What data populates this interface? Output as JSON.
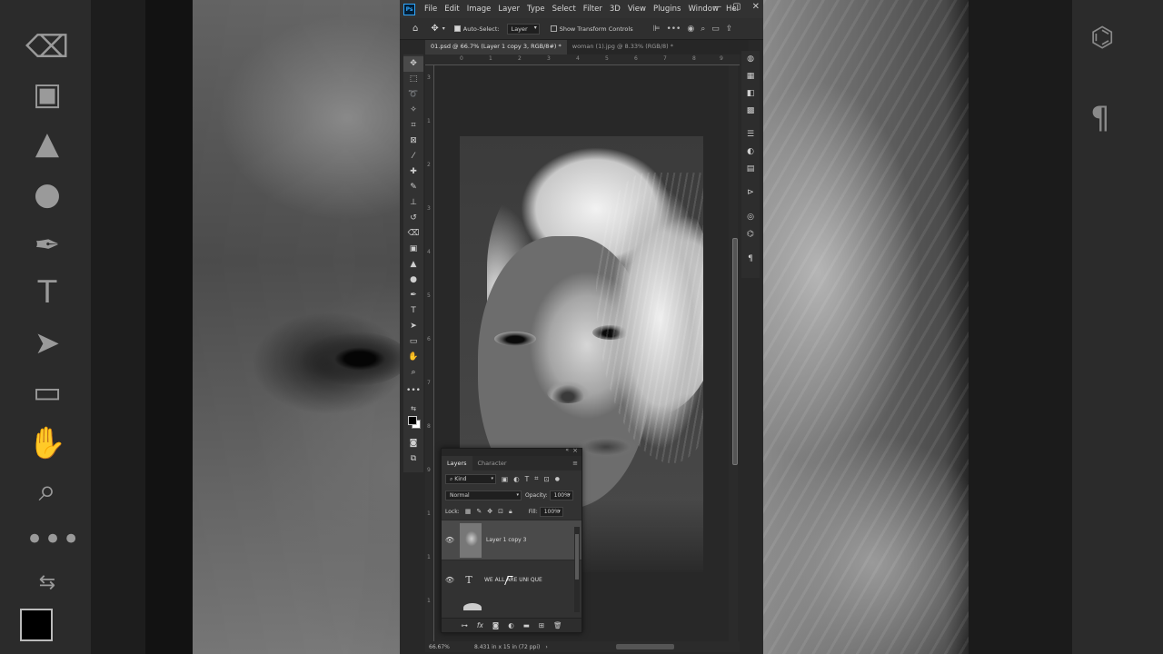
{
  "menubar": {
    "app_icon": "Ps",
    "items": [
      "File",
      "Edit",
      "Image",
      "Layer",
      "Type",
      "Select",
      "Filter",
      "3D",
      "View",
      "Plugins",
      "Window",
      "Hel"
    ],
    "window_controls": [
      "—",
      "▢",
      "✕"
    ]
  },
  "options_bar": {
    "auto_select_label": "Auto-Select:",
    "auto_select_value": "Layer",
    "show_transform_label": "Show Transform Controls"
  },
  "tabs": [
    {
      "label": "01.psd @ 66.7% (Layer 1 copy 3, RGB/8#) *",
      "active": true
    },
    {
      "label": "woman (1).jpg @ 8.33% (RGB/8) *",
      "active": false
    }
  ],
  "ruler": {
    "h_ticks": [
      "0",
      "1",
      "2",
      "3",
      "4",
      "5",
      "6",
      "7",
      "8",
      "9"
    ],
    "v_ticks": [
      "3",
      "1",
      "2",
      "3",
      "4",
      "5",
      "6",
      "7",
      "8",
      "9",
      "1",
      "1",
      "1"
    ]
  },
  "status_bar": {
    "zoom": "66.67%",
    "doc_size": "8.431 in x 15 in (72 ppi)"
  },
  "layers_panel": {
    "tabs": [
      "Layers",
      "Character"
    ],
    "filter_kind": "Kind",
    "blend_mode": "Normal",
    "opacity_label": "Opacity:",
    "opacity_value": "100%",
    "lock_label": "Lock:",
    "fill_label": "Fill:",
    "fill_value": "100%",
    "layers": [
      {
        "name": "Layer 1 copy 3",
        "type": "image",
        "active": true
      },
      {
        "name": "WE ALL ARE UNI QUE",
        "type": "text",
        "active": false
      }
    ],
    "bottom_icons": [
      "link-icon",
      "fx-icon",
      "mask-icon",
      "adjustment-icon",
      "folder-icon",
      "new-layer-icon",
      "trash-icon"
    ]
  },
  "colors": {
    "accent": "#31a8ff",
    "panel": "#323232",
    "canvas_bg": "#282828"
  }
}
